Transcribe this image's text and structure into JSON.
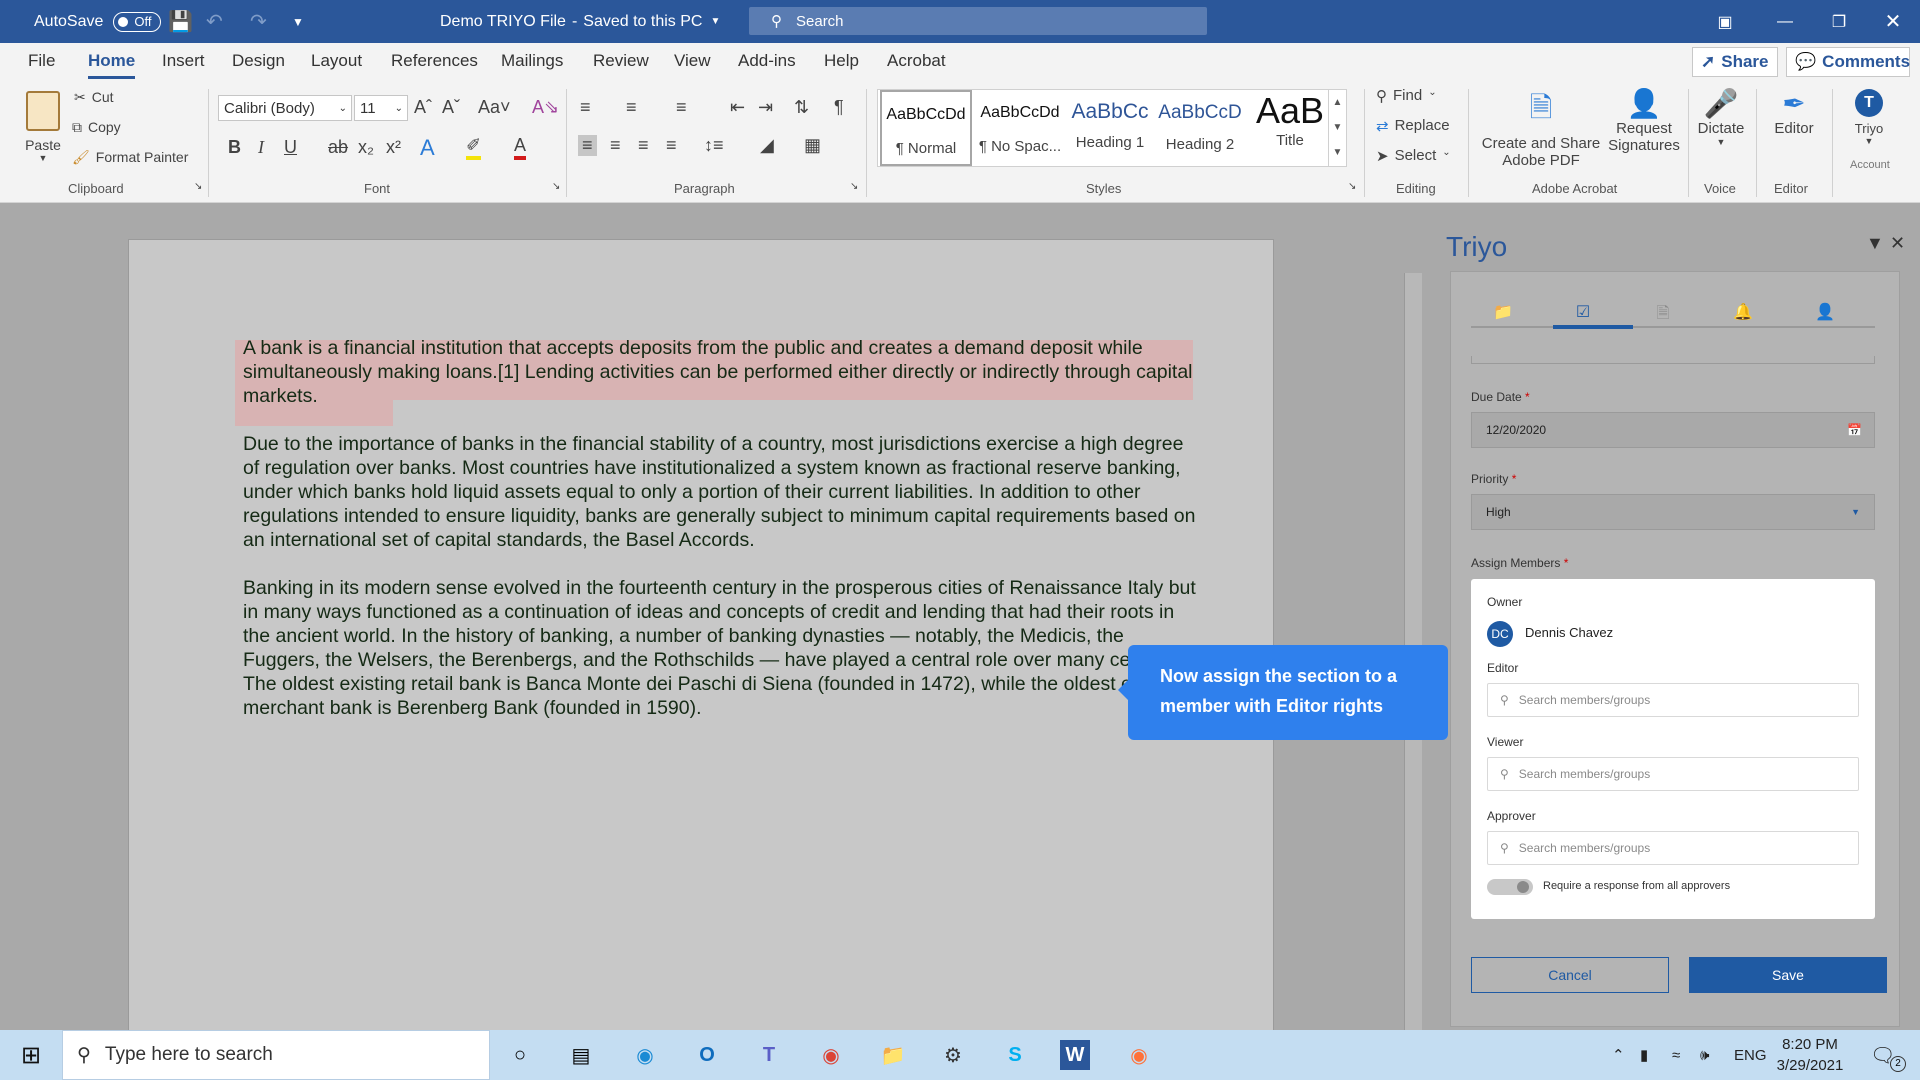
{
  "titlebar": {
    "autosave_label": "AutoSave",
    "autosave_state": "Off",
    "doc_title": "Demo TRIYO File",
    "save_status": "Saved to this PC",
    "search_placeholder": "Search"
  },
  "ribbon_tabs": [
    "File",
    "Home",
    "Insert",
    "Design",
    "Layout",
    "References",
    "Mailings",
    "Review",
    "View",
    "Add-ins",
    "Help",
    "Acrobat"
  ],
  "active_tab": "Home",
  "share_label": "Share",
  "comments_label": "Comments",
  "clipboard": {
    "paste": "Paste",
    "cut": "Cut",
    "copy": "Copy",
    "format_painter": "Format Painter",
    "group": "Clipboard"
  },
  "font": {
    "name": "Calibri (Body)",
    "size": "11",
    "group": "Font"
  },
  "paragraph_group": "Paragraph",
  "styles": {
    "items": [
      {
        "preview": "AaBbCcDd",
        "name": "¶ Normal"
      },
      {
        "preview": "AaBbCcDd",
        "name": "¶ No Spac..."
      },
      {
        "preview": "AaBbCc",
        "name": "Heading 1"
      },
      {
        "preview": "AaBbCcD",
        "name": "Heading 2"
      },
      {
        "preview": "AaB",
        "name": "Title"
      }
    ],
    "group": "Styles"
  },
  "editing": {
    "find": "Find",
    "replace": "Replace",
    "select": "Select",
    "group": "Editing"
  },
  "acrobat": {
    "create_share": "Create and Share",
    "adobe_pdf": "Adobe PDF",
    "request": "Request",
    "signatures": "Signatures",
    "group": "Adobe Acrobat"
  },
  "voice": {
    "dictate": "Dictate",
    "group": "Voice"
  },
  "editor": {
    "label": "Editor",
    "group": "Editor"
  },
  "account": {
    "triyo": "Triyo",
    "label": "Account"
  },
  "document": {
    "para1": "A bank is a financial institution that accepts deposits from the public and creates a demand deposit while simultaneously making loans.[1] Lending activities can be performed either directly or indirectly through capital markets.",
    "para2": "Due to the importance of banks in the financial stability of a country, most jurisdictions exercise a high degree of regulation over banks. Most countries have institutionalized a system known as fractional reserve banking, under which banks hold liquid assets equal to only a portion of their current liabilities. In addition to other regulations intended to ensure liquidity, banks are generally subject to minimum capital requirements based on an international set of capital standards, the Basel Accords.",
    "para3": "Banking in its modern sense evolved in the fourteenth century in the prosperous cities of Renaissance Italy but in many ways functioned as a continuation of ideas and concepts of credit and lending that had their roots in the ancient world. In the history of banking, a number of banking dynasties — notably, the Medicis, the Fuggers, the Welsers, the Berenbergs, and the Rothschilds — have played a central role over many centuries. The oldest existing retail bank is Banca Monte dei Paschi di Siena (founded in 1472), while the oldest existing merchant bank is Berenberg Bank (founded in 1590)."
  },
  "tooltip": "Now assign the section to a member with Editor rights",
  "triyo": {
    "title": "Triyo",
    "due_date_label": "Due Date",
    "due_date": "12/20/2020",
    "priority_label": "Priority",
    "priority": "High",
    "assign_label": "Assign Members",
    "owner_label": "Owner",
    "owner_initials": "DC",
    "owner_name": "Dennis Chavez",
    "editor_label": "Editor",
    "viewer_label": "Viewer",
    "approver_label": "Approver",
    "search_placeholder": "Search members/groups",
    "require_label": "Require a response from all approvers",
    "cancel": "Cancel",
    "save": "Save"
  },
  "taskbar": {
    "search_placeholder": "Type here to search",
    "lang": "ENG",
    "time": "8:20 PM",
    "date": "3/29/2021",
    "notif_count": "2"
  }
}
